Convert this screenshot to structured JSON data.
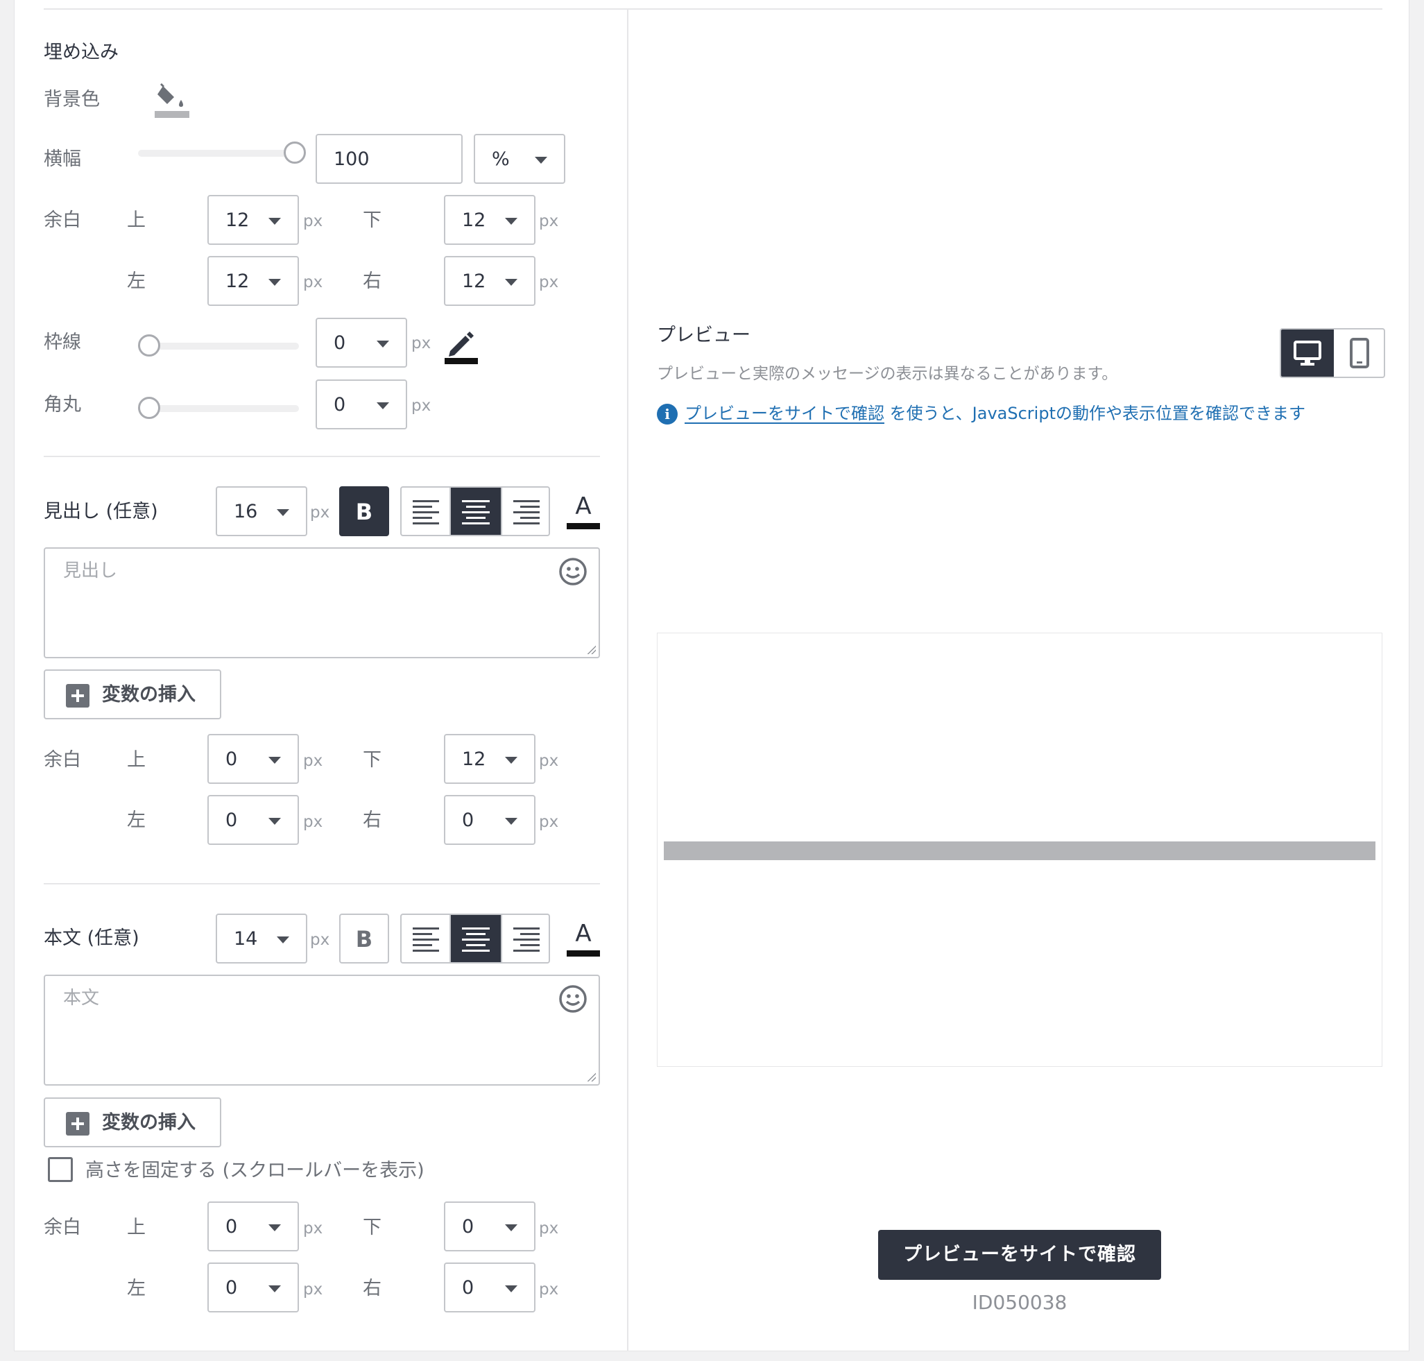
{
  "fill": {
    "section_title": "埋め込み",
    "bg_color_label": "背景色",
    "width_label": "横幅",
    "width_value": "100",
    "width_unit": "%",
    "margin_label": "余白",
    "top_label": "上",
    "bottom_label": "下",
    "left_label": "左",
    "right_label": "右",
    "margin_top": "12",
    "margin_bottom": "12",
    "margin_left": "12",
    "margin_right": "12",
    "border_label": "枠線",
    "border_value": "0",
    "radius_label": "角丸",
    "radius_value": "0",
    "unit_px": "px"
  },
  "heading": {
    "label": "見出し (任意)",
    "font_size": "16",
    "bold_label": "B",
    "color_label": "A",
    "placeholder": "見出し",
    "insert_variable": "変数の挿入",
    "margin_top": "0",
    "margin_bottom": "12",
    "margin_left": "0",
    "margin_right": "0"
  },
  "body": {
    "label": "本文 (任意)",
    "font_size": "14",
    "bold_label": "B",
    "color_label": "A",
    "placeholder": "本文",
    "insert_variable": "変数の挿入",
    "fixed_height_label": "高さを固定する (スクロールバーを表示)",
    "margin_top": "0",
    "margin_bottom": "0",
    "margin_left": "0",
    "margin_right": "0"
  },
  "preview": {
    "title": "プレビュー",
    "note": "プレビューと実際のメッセージの表示は異なることがあります。",
    "link_text": "プレビューをサイトで確認",
    "link_suffix": " を使うと、JavaScriptの動作や表示位置を確認できます",
    "confirm_button": "プレビューをサイトで確認",
    "id_text": "ID050038"
  },
  "colors": {
    "dark": "#2f3440",
    "link": "#1f6fb2",
    "embed_bar": "#b4b5b8"
  }
}
